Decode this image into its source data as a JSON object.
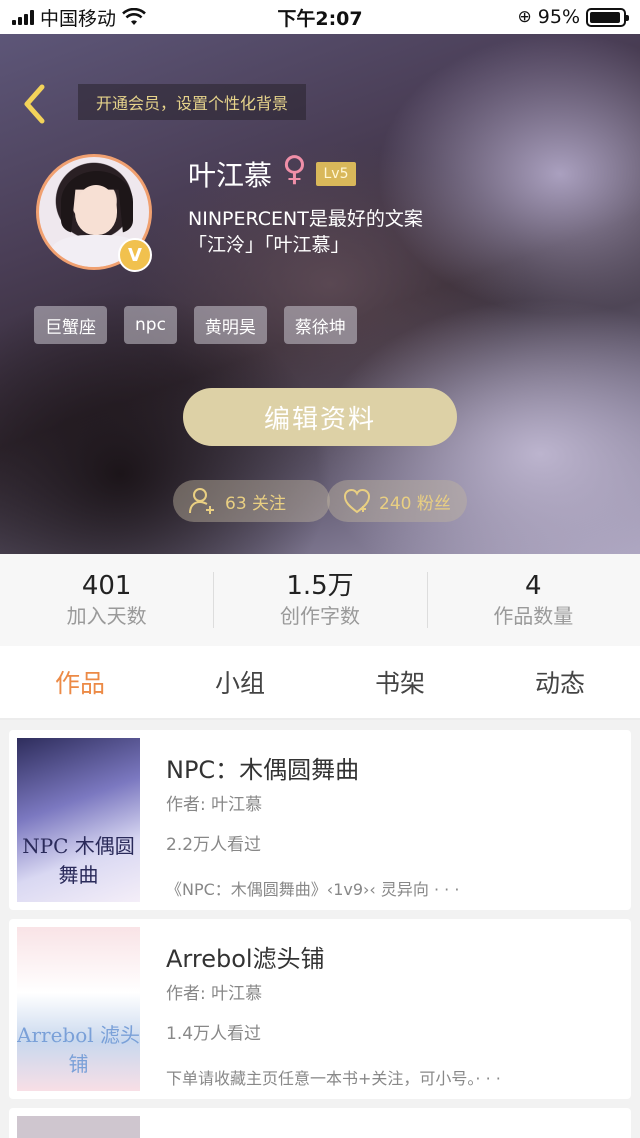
{
  "status_bar": {
    "carrier": "中国移动",
    "time": "下午2:07",
    "battery": "95%",
    "battery_level": 0.95
  },
  "header": {
    "member_banner": "开通会员，设置个性化背景",
    "username": "叶江慕",
    "gender_symbol": "♀",
    "level": "Lv5",
    "vip_badge": "V",
    "bio_line1": "NINPERCENT是最好的文案",
    "bio_line2": "「江泠」「叶江慕」",
    "tags": [
      "巨蟹座",
      "npc",
      "黄明昊",
      "蔡徐坤"
    ],
    "edit_button": "编辑资料",
    "following": "63 关注",
    "followers": "240 粉丝"
  },
  "stats": [
    {
      "value": "401",
      "label": "加入天数"
    },
    {
      "value": "1.5万",
      "label": "创作字数"
    },
    {
      "value": "4",
      "label": "作品数量"
    }
  ],
  "tabs": [
    "作品",
    "小组",
    "书架",
    "动态"
  ],
  "active_tab": "作品",
  "works": [
    {
      "title": "NPC：木偶圆舞曲",
      "author": "作者: 叶江慕",
      "views": "2.2万人看过",
      "desc": "《NPC：木偶圆舞曲》‹1v9›‹ 灵异向 · · ·",
      "cover_text": "NPC 木偶圆舞曲"
    },
    {
      "title": "Arrebol滤头铺",
      "author": "作者: 叶江慕",
      "views": "1.4万人看过",
      "desc": "下单请收藏主页任意一本书+关注，可小号。· · ·",
      "cover_text": "Arrebol 滤头铺"
    }
  ],
  "colors": {
    "accent": "#ec8a46",
    "gold": "#e6d38b",
    "edit_button": "#ddd1a6"
  }
}
